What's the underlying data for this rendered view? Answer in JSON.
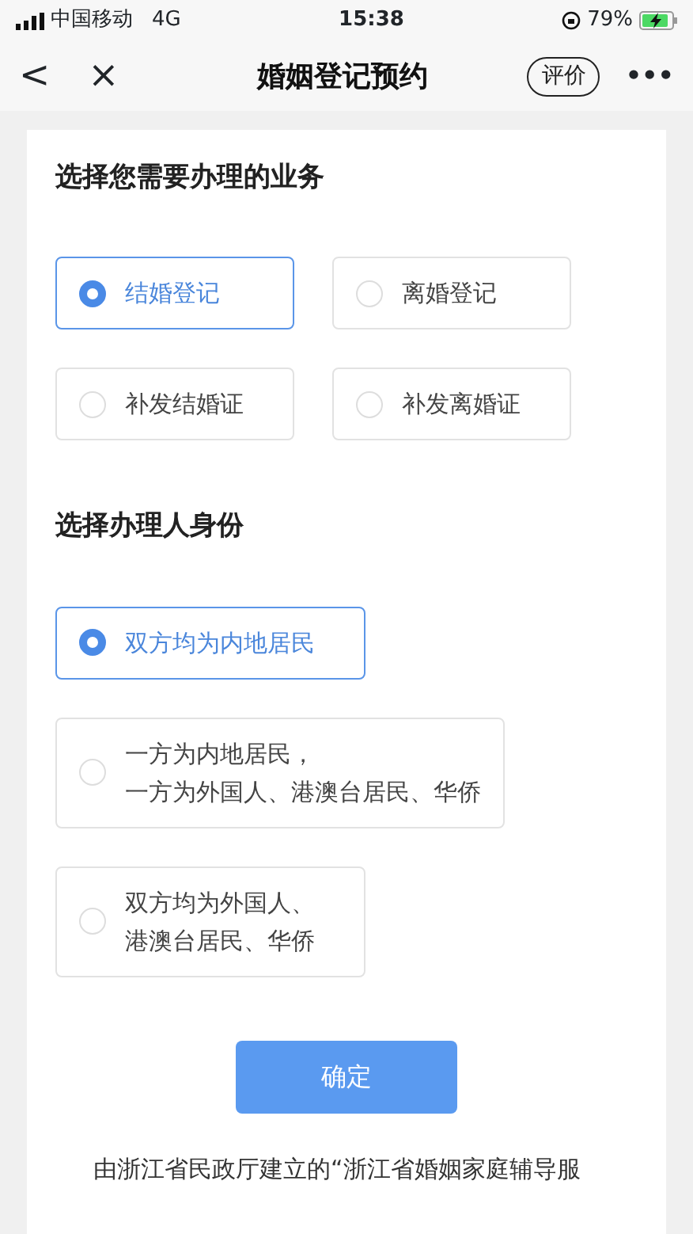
{
  "status_bar": {
    "carrier": "中国移动",
    "network": "4G",
    "time": "15:38",
    "battery": "79%"
  },
  "nav_bar": {
    "back": "<",
    "close": "×",
    "title": "婚姻登记预约",
    "rate_button": "评价",
    "more": "•••"
  },
  "sections": [
    {
      "title": "选择您需要办理的业务",
      "kind": "grid",
      "options": [
        {
          "label": "结婚登记",
          "selected": true
        },
        {
          "label": "离婚登记",
          "selected": false
        },
        {
          "label": "补发结婚证",
          "selected": false
        },
        {
          "label": "补发离婚证",
          "selected": false
        }
      ]
    },
    {
      "title": "选择办理人身份",
      "kind": "stack",
      "options": [
        {
          "label": "双方均为内地居民",
          "selected": true
        },
        {
          "label": "一方为内地居民，",
          "label_line_2": "一方为外国人、港澳台居民、华侨",
          "selected": false
        },
        {
          "label": "双方均为外国人、",
          "label_line_2": "港澳台居民、华侨",
          "selected": false
        }
      ]
    }
  ],
  "confirm_button": "确定",
  "footer_text": "由浙江省民政厅建立的“浙江省婚姻家庭辅导服"
}
